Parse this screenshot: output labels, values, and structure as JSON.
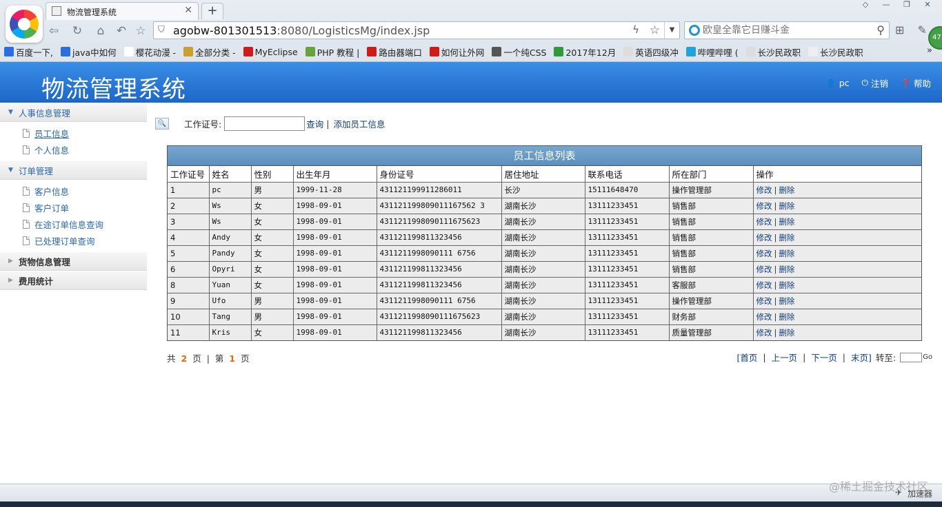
{
  "browser": {
    "tab_title": "物流管理系统",
    "tab_close": "✕",
    "new_tab": "+",
    "url_host": "agobw-801301513",
    "url_rest": ":8080/LogisticsMg/index.jsp",
    "search_placeholder": "欧皇全靠它日赚斗金",
    "bookmarks": [
      {
        "label": "百度一下,",
        "color": "#2a6ee0"
      },
      {
        "label": "java中如何",
        "color": "#2a6ee0"
      },
      {
        "label": "樱花动漫 -",
        "color": "#ffffff"
      },
      {
        "label": "全部分类 -",
        "color": "#c8a030"
      },
      {
        "label": "MyEclipse",
        "color": "#d01b1b"
      },
      {
        "label": "PHP 教程 |",
        "color": "#68a33a"
      },
      {
        "label": "路由器端口",
        "color": "#d01b1b"
      },
      {
        "label": "如何让外网",
        "color": "#d01b1b"
      },
      {
        "label": "一个纯CSS",
        "color": "#555555"
      },
      {
        "label": "2017年12月",
        "color": "#2e9a3a"
      },
      {
        "label": "英语四级冲",
        "color": "#dddddd"
      },
      {
        "label": "哔哩哔哩 (",
        "color": "#23a2de"
      },
      {
        "label": "长沙民政职",
        "color": "#dddddd"
      },
      {
        "label": "长沙民政职",
        "color": "#eeeeee"
      }
    ],
    "bookmarks_more": "»",
    "avatar_badge": "47"
  },
  "header": {
    "title": "物流管理系统",
    "user": "pc",
    "logout": "注销",
    "help": "帮助"
  },
  "sidebar": {
    "sections": [
      {
        "label": "人事信息管理",
        "open": true,
        "items": [
          "员工信息",
          "个人信息"
        ]
      },
      {
        "label": "订单管理",
        "open": true,
        "items": [
          "客户信息",
          "客户订单",
          "在途订单信息查询",
          "已处理订单查询"
        ]
      },
      {
        "label": "货物信息管理",
        "open": false,
        "items": []
      },
      {
        "label": "费用统计",
        "open": false,
        "items": []
      }
    ]
  },
  "search": {
    "button_icon": "🔍",
    "label": "工作证号:",
    "value": "",
    "query_link": "查询",
    "separator": "|",
    "add_link": "添加员工信息"
  },
  "table": {
    "caption": "员工信息列表",
    "columns": [
      "工作证号",
      "姓名",
      "性别",
      "出生年月",
      "身份证号",
      "居住地址",
      "联系电话",
      "所在部门",
      "操作"
    ],
    "edit_label": "修改",
    "delete_label": "删除",
    "pipe": "|",
    "rows": [
      [
        "1",
        "pc",
        "男",
        "1999-11-28",
        "431121199911286011",
        "长沙",
        "15111648470",
        "操作管理部"
      ],
      [
        "2",
        "Ws",
        "女",
        "1998-09-01",
        "431121199809011167562 3",
        "湖南长沙",
        "13111233451",
        "销售部"
      ],
      [
        "3",
        "Ws",
        "女",
        "1998-09-01",
        "4311211998090111675623",
        "湖南长沙",
        "13111233451",
        "销售部"
      ],
      [
        "4",
        "Andy",
        "女",
        "1998-09-01",
        "431121199811323456",
        "湖南长沙",
        "13111233451",
        "销售部"
      ],
      [
        "5",
        "Pandy",
        "女",
        "1998-09-01",
        "4311211998090111 6756",
        "湖南长沙",
        "13111233451",
        "销售部"
      ],
      [
        "6",
        "Opyri",
        "女",
        "1998-09-01",
        "431121199811323456",
        "湖南长沙",
        "13111233451",
        "销售部"
      ],
      [
        "8",
        "Yuan",
        "女",
        "1998-09-01",
        "431121199811323456",
        "湖南长沙",
        "13111233451",
        "客服部"
      ],
      [
        "9",
        "Ufo",
        "男",
        "1998-09-01",
        "4311211998090111 6756",
        "湖南长沙",
        "13111233451",
        "操作管理部"
      ],
      [
        "10",
        "Tang",
        "男",
        "1998-09-01",
        "4311211998090111675623",
        "湖南长沙",
        "13111233451",
        "财务部"
      ],
      [
        "11",
        "Kris",
        "女",
        "1998-09-01",
        "431121199811323456",
        "湖南长沙",
        "13111233451",
        "质量管理部"
      ]
    ]
  },
  "pager": {
    "total_prefix": "共",
    "total_pages": "2",
    "page_unit": "页",
    "divider": "|",
    "current_prefix": "第",
    "current_page": "1",
    "current_unit": "页",
    "first": "[首页",
    "prev": "上一页",
    "next": "下一页",
    "last": "末页]",
    "sep": "|",
    "goto_label": "转至:",
    "go": "Go"
  },
  "statusbar": {
    "accelerator": "加速器",
    "watermark": "@稀土掘金技术社区"
  }
}
